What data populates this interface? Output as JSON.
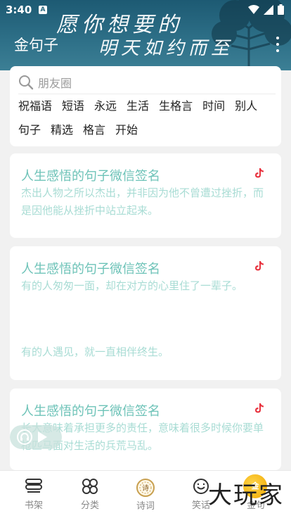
{
  "status": {
    "time": "3:40",
    "badge": "A"
  },
  "header": {
    "app_title": "金句子",
    "banner_line1": "愿你想要的",
    "banner_line2": "明天如约而至"
  },
  "search": {
    "placeholder": "朋友圈"
  },
  "tags": [
    "祝福语",
    "短语",
    "永远",
    "生活",
    "生格言",
    "时间",
    "别人",
    "句子",
    "精选",
    "格言",
    "开始"
  ],
  "cards": [
    {
      "title": "人生感悟的句子微信签名",
      "body": "杰出人物之所以杰出，并非因为他不曾遭过挫折，而是因他能从挫折中站立起来。",
      "body2": ""
    },
    {
      "title": "人生感悟的句子微信签名",
      "body": "有的人匆匆一面，却在对方的心里住了一辈子。",
      "body2": "有的人遇见，就一直相伴终生。"
    },
    {
      "title": "人生感悟的句子微信签名",
      "body": "长大意味着承担更多的责任，意味着很多时候你要单枪匹马面对生活的兵荒马乱。",
      "body2": ""
    }
  ],
  "tabs": [
    {
      "label": "书架",
      "icon": "bookshelf-icon"
    },
    {
      "label": "分类",
      "icon": "category-icon"
    },
    {
      "label": "诗词",
      "icon": "poem-icon"
    },
    {
      "label": "笑话",
      "icon": "smile-icon"
    },
    {
      "label": "金句",
      "icon": "quote-icon"
    }
  ],
  "watermark": {
    "text": "大玩家",
    "badge": "金"
  },
  "colors": {
    "accent": "#6ec3b8",
    "banner": "#2d6f87"
  }
}
